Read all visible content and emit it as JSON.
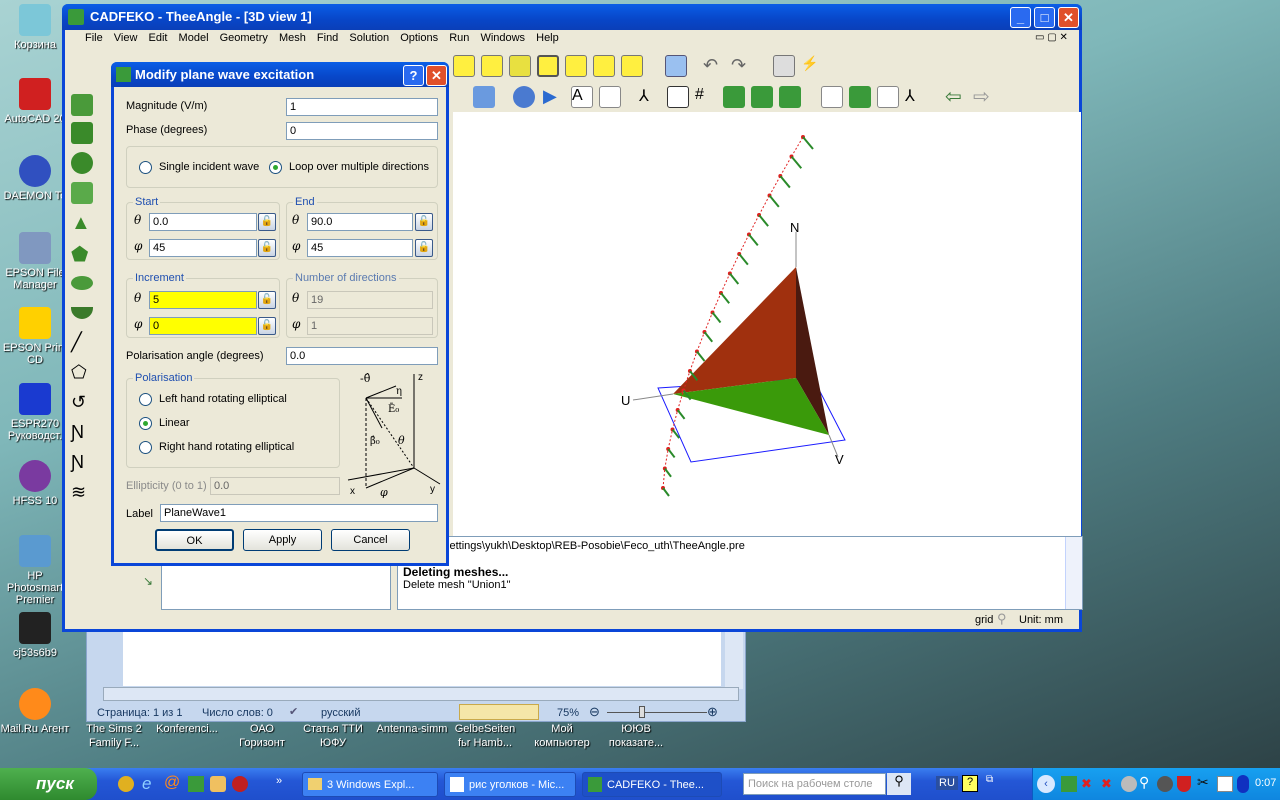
{
  "desktop": {
    "icons_left": [
      "Корзина",
      "AutoCAD 20",
      "DAEMON To",
      "EPSON File Manager",
      "EPSON Print CD",
      "ESPR270 Руководст.",
      "HFSS 10",
      "HP Photosmart Premier",
      "cj53s6b9",
      "Mail.Ru Агент"
    ],
    "icons_bottom": [
      "The Sims 2 Family F...",
      "Konferenci...",
      "ОАО Горизонт",
      "Статья ТТИ ЮФУ",
      "Antenna-simm",
      "GelbeSeiten fьr Hamb...",
      "Мой компьютер",
      "ЮЮВ показате..."
    ]
  },
  "window": {
    "title": "CADFEKO - TheeAngle - [3D view 1]",
    "menu": [
      "File",
      "View",
      "Edit",
      "Model",
      "Geometry",
      "Mesh",
      "Find",
      "Solution",
      "Options",
      "Run",
      "Windows",
      "Help"
    ],
    "output_lines": [
      "nts and Settings\\yukh\\Desktop\\REB-Posobie\\Feco_uth\\TheeAngle.pre",
      "Deleting meshes...",
      "Delete mesh \"Union1\""
    ],
    "status": {
      "grid": "grid",
      "unit": "Unit: mm"
    },
    "view_labels": {
      "n": "N",
      "u": "U",
      "v": "V"
    }
  },
  "dialog": {
    "title": "Modify plane wave excitation",
    "magnitude_label": "Magnitude (V/m)",
    "magnitude": "1",
    "phase_label": "Phase (degrees)",
    "phase": "0",
    "mode_single": "Single incident wave",
    "mode_loop": "Loop over multiple directions",
    "mode_selected": "loop",
    "start_title": "Start",
    "start_theta": "0.0",
    "start_phi": "45",
    "end_title": "End",
    "end_theta": "90.0",
    "end_phi": "45",
    "inc_title": "Increment",
    "inc_theta": "5",
    "inc_phi": "0",
    "ndir_title": "Number of directions",
    "ndir_theta": "19",
    "ndir_phi": "1",
    "theta_sym": "θ",
    "phi_sym": "φ",
    "pol_angle_label": "Polarisation angle (degrees)",
    "pol_angle": "0.0",
    "pol_title": "Polarisation",
    "pol_left": "Left hand rotating elliptical",
    "pol_linear": "Linear",
    "pol_right": "Right hand rotating elliptical",
    "pol_selected": "linear",
    "ellipticity_label": "Ellipticity (0 to 1)",
    "ellipticity": "0.0",
    "label_label": "Label",
    "label": "PlaneWave1",
    "ok": "OK",
    "apply": "Apply",
    "cancel": "Cancel",
    "diagram": {
      "theta_hat": "-θ̂",
      "eta": "η",
      "e0": "Ē₀",
      "beta": "β̂₀",
      "theta": "θ",
      "phi": "φ",
      "x": "x",
      "y": "y",
      "z": "z"
    }
  },
  "word": {
    "page": "Страница: 1 из 1",
    "words": "Число слов: 0",
    "lang": "русский",
    "zoom": "75%",
    "zoom_level": 75
  },
  "taskbar": {
    "start": "пуск",
    "tasks": [
      "3 Windows Expl...",
      "рис уголков - Mic...",
      "CADFEKO - Thee..."
    ],
    "search_placeholder": "Поиск на рабочем столе",
    "lang": "RU",
    "clock": "0:07"
  }
}
